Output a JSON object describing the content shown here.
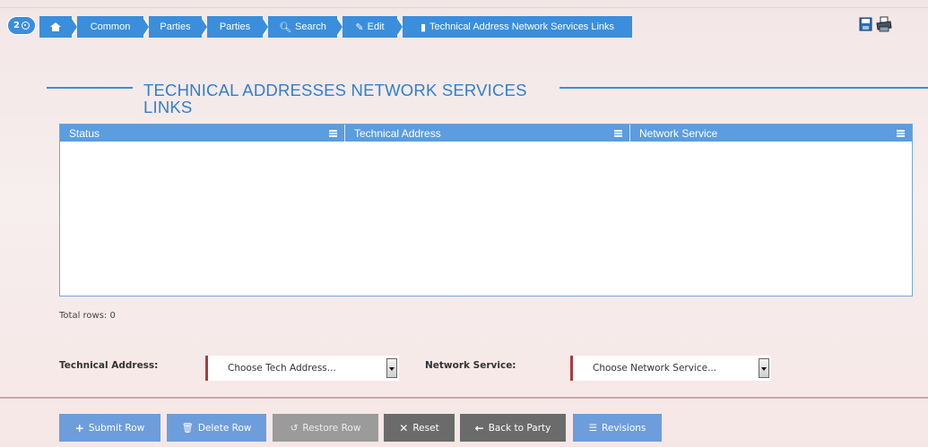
{
  "breadcrumb": {
    "badge_count": "2",
    "items": [
      {
        "label": "Common"
      },
      {
        "label": "Parties"
      },
      {
        "label": "Parties"
      },
      {
        "label": "Search"
      },
      {
        "label": "Edit"
      },
      {
        "label": "Technical Address Network Services Links"
      }
    ]
  },
  "page": {
    "title_line1": "TECHNICAL ADDRESSES NETWORK SERVICES",
    "title_line2": "LINKS"
  },
  "grid": {
    "columns": [
      "Status",
      "Technical Address",
      "Network Service"
    ],
    "rows": [],
    "total_rows_label": "Total rows: 0"
  },
  "form": {
    "tech_address_label": "Technical Address:",
    "tech_address_value": "Choose Tech Address...",
    "network_service_label": "Network Service:",
    "network_service_value": "Choose Network Service..."
  },
  "buttons": {
    "submit": "Submit Row",
    "delete": "Delete Row",
    "restore": "Restore Row",
    "reset": "Reset",
    "back": "Back to Party",
    "revisions": "Revisions"
  },
  "colors": {
    "accent": "#3a8edc",
    "grid_header": "#5a9de0",
    "mandatory_marker": "#b2383a"
  },
  "icons": [
    "eye-icon",
    "home-icon",
    "search-icon",
    "edit-icon",
    "bookmark-icon",
    "save-icon",
    "print-icon",
    "column-menu-icon",
    "plus-icon",
    "trash-icon",
    "restore-icon",
    "times-icon",
    "arrow-left-icon",
    "database-icon"
  ]
}
